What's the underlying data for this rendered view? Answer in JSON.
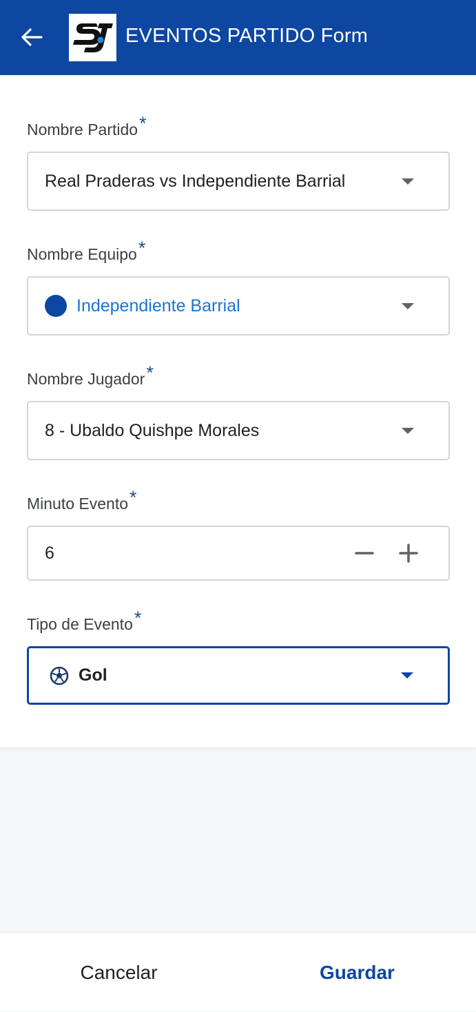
{
  "header": {
    "title": "EVENTOS PARTIDO Form",
    "back_icon": "arrow-left-icon",
    "logo": "SJ",
    "background_color": "#0d47a1"
  },
  "form": {
    "required_marker": "*",
    "match": {
      "label": "Nombre Partido",
      "value": "Real Praderas vs Independiente Barrial"
    },
    "team": {
      "label": "Nombre Equipo",
      "value": "Independiente Barrial",
      "color": "#1976d2",
      "dot_color": "#0d47a1"
    },
    "player": {
      "label": "Nombre Jugador",
      "value": "8 - Ubaldo Quishpe Morales"
    },
    "minute": {
      "label": "Minuto Evento",
      "value": "6",
      "decrement_icon": "minus-icon",
      "increment_icon": "plus-icon"
    },
    "event_type": {
      "label": "Tipo de Evento",
      "value": "Gol",
      "icon": "soccer-ball-icon"
    }
  },
  "footer": {
    "cancel_label": "Cancelar",
    "save_label": "Guardar"
  }
}
